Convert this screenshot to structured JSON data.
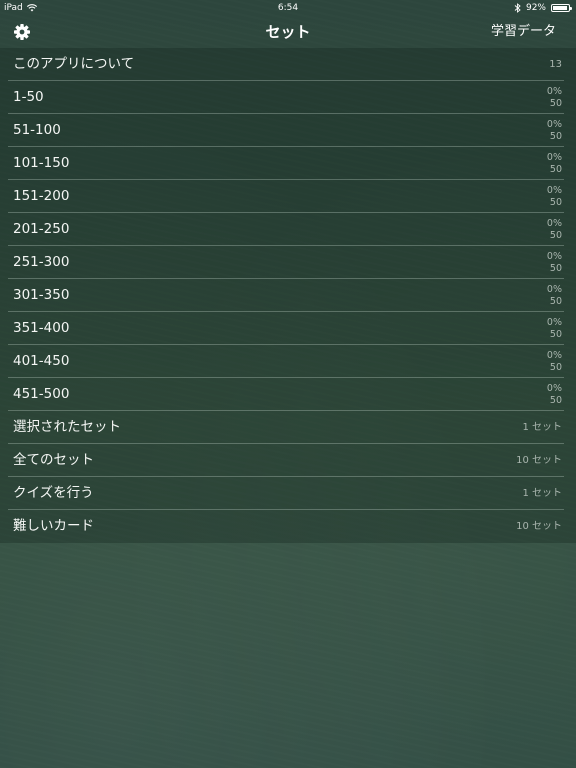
{
  "status_bar": {
    "device": "iPad",
    "time": "6:54",
    "battery_text": "92%",
    "battery_level": 0.92
  },
  "nav": {
    "title": "セット",
    "right_button": "学習データ",
    "left_icon": "gear-icon"
  },
  "about_row": {
    "label": "このアプリについて",
    "value": "13"
  },
  "sets": [
    {
      "label": "1-50",
      "progress": "0%",
      "count": "50"
    },
    {
      "label": "51-100",
      "progress": "0%",
      "count": "50"
    },
    {
      "label": "101-150",
      "progress": "0%",
      "count": "50"
    },
    {
      "label": "151-200",
      "progress": "0%",
      "count": "50"
    },
    {
      "label": "201-250",
      "progress": "0%",
      "count": "50"
    },
    {
      "label": "251-300",
      "progress": "0%",
      "count": "50"
    },
    {
      "label": "301-350",
      "progress": "0%",
      "count": "50"
    },
    {
      "label": "351-400",
      "progress": "0%",
      "count": "50"
    },
    {
      "label": "401-450",
      "progress": "0%",
      "count": "50"
    },
    {
      "label": "451-500",
      "progress": "0%",
      "count": "50"
    }
  ],
  "actions": [
    {
      "label": "選択されたセット",
      "value": "1 セット"
    },
    {
      "label": "全てのセット",
      "value": "10 セット"
    },
    {
      "label": "クイズを行う",
      "value": "1 セット"
    },
    {
      "label": "難しいカード",
      "value": "10 セット"
    }
  ],
  "colors": {
    "background": "#2f4a41",
    "text": "#ffffff",
    "secondary_text": "#a9b5ae"
  }
}
